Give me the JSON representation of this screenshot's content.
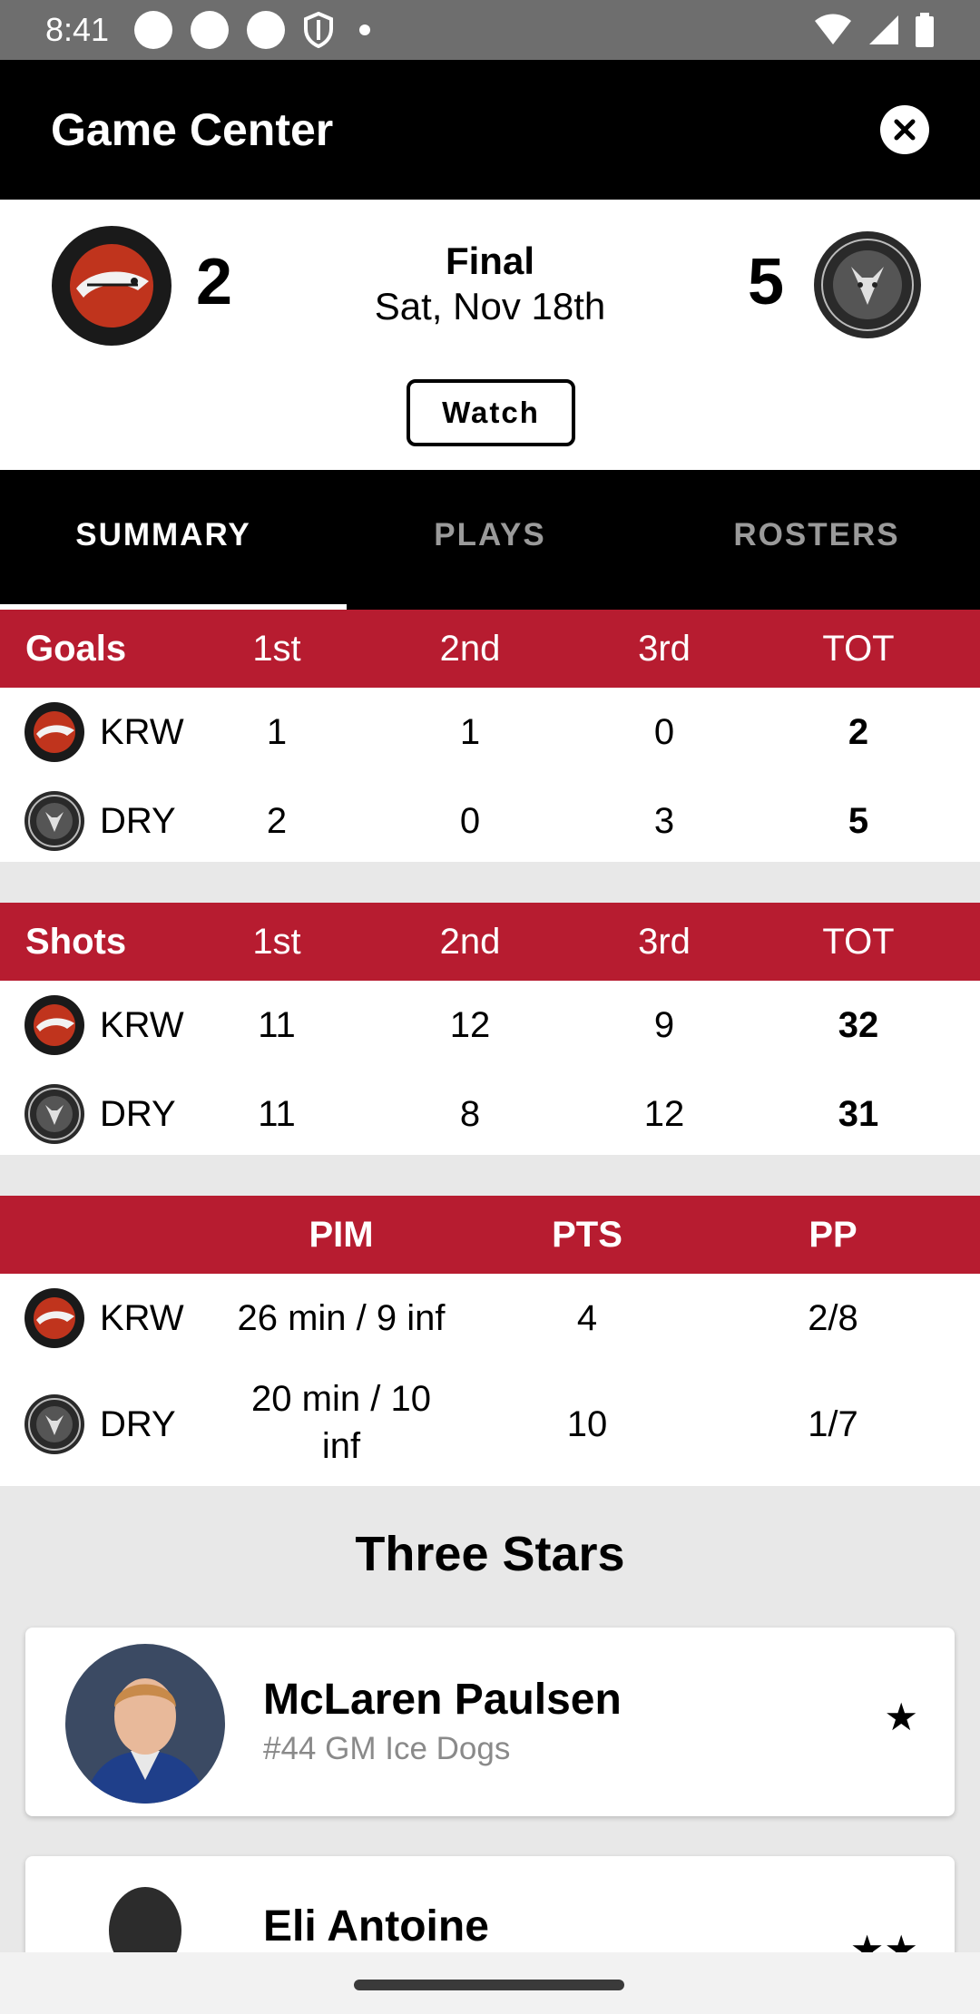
{
  "status_bar": {
    "time": "8:41"
  },
  "app_bar": {
    "title": "Game Center"
  },
  "game": {
    "home": {
      "abbr": "KRW",
      "score": "2"
    },
    "away": {
      "abbr": "DRY",
      "score": "5"
    },
    "status": "Final",
    "date": "Sat, Nov 18th",
    "watch_label": "Watch"
  },
  "tabs": [
    {
      "label": "SUMMARY",
      "active": true
    },
    {
      "label": "PLAYS",
      "active": false
    },
    {
      "label": "ROSTERS",
      "active": false
    }
  ],
  "goals": {
    "headers": [
      "Goals",
      "1st",
      "2nd",
      "3rd",
      "TOT"
    ],
    "rows": [
      {
        "team": "KRW",
        "p1": "1",
        "p2": "1",
        "p3": "0",
        "tot": "2"
      },
      {
        "team": "DRY",
        "p1": "2",
        "p2": "0",
        "p3": "3",
        "tot": "5"
      }
    ]
  },
  "shots": {
    "headers": [
      "Shots",
      "1st",
      "2nd",
      "3rd",
      "TOT"
    ],
    "rows": [
      {
        "team": "KRW",
        "p1": "11",
        "p2": "12",
        "p3": "9",
        "tot": "32"
      },
      {
        "team": "DRY",
        "p1": "11",
        "p2": "8",
        "p3": "12",
        "tot": "31"
      }
    ]
  },
  "penalties": {
    "headers": [
      "",
      "PIM",
      "PTS",
      "PP"
    ],
    "rows": [
      {
        "team": "KRW",
        "pim": "26 min / 9 inf",
        "pts": "4",
        "pp": "2/8"
      },
      {
        "team": "DRY",
        "pim_line1": "20 min / 10",
        "pim_line2": "inf",
        "pts": "10",
        "pp": "1/7"
      }
    ]
  },
  "three_stars": {
    "title": "Three Stars",
    "players": [
      {
        "name": "McLaren Paulsen",
        "detail": "#44 GM Ice Dogs",
        "stars": "★"
      },
      {
        "name": "Eli Antoine",
        "detail": "",
        "stars": "★★"
      }
    ]
  },
  "colors": {
    "accent_red": "#b71c30",
    "header_black": "#000000",
    "background_gray": "#e8e8e8"
  }
}
